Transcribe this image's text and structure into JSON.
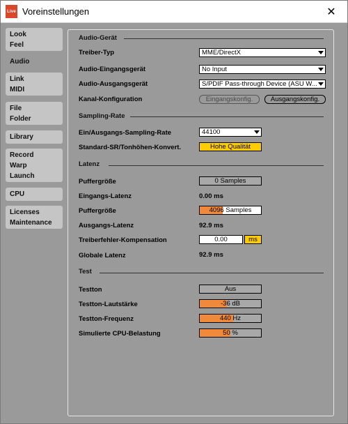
{
  "window": {
    "title": "Voreinstellungen",
    "app_icon_text": "Live",
    "close_glyph": "✕"
  },
  "sidebar": {
    "items": [
      {
        "lines": [
          "Look",
          "Feel"
        ],
        "active": false
      },
      {
        "lines": [
          "Audio"
        ],
        "active": true
      },
      {
        "lines": [
          "Link",
          "MIDI"
        ],
        "active": false
      },
      {
        "lines": [
          "File",
          "Folder"
        ],
        "active": false
      },
      {
        "lines": [
          "Library"
        ],
        "active": false
      },
      {
        "lines": [
          "Record",
          "Warp",
          "Launch"
        ],
        "active": false
      },
      {
        "lines": [
          "CPU"
        ],
        "active": false
      },
      {
        "lines": [
          "Licenses",
          "Maintenance"
        ],
        "active": false
      }
    ]
  },
  "audio_device": {
    "title": "Audio-Gerät",
    "driver_type": {
      "label": "Treiber-Typ",
      "value": "MME/DirectX"
    },
    "input_device": {
      "label": "Audio-Eingangsgerät",
      "value": "No Input"
    },
    "output_device": {
      "label": "Audio-Ausgangsgerät",
      "value": "S/PDIF Pass-through Device (ASU W..."
    },
    "channel_config": {
      "label": "Kanal-Konfiguration",
      "input_button": "Eingangskonfig.",
      "output_button": "Ausgangskonfig."
    }
  },
  "sampling_rate": {
    "title": "Sampling-Rate",
    "io_rate": {
      "label": "Ein/Ausgangs-Sampling-Rate",
      "value": "44100"
    },
    "default_sr": {
      "label": "Standard-SR/Tonhöhen-Konvert.",
      "value": "Hohe Qualität"
    }
  },
  "latency": {
    "title": "Latenz",
    "buffer_in": {
      "label": "Puffergröße",
      "value": "0 Samples"
    },
    "input_latency": {
      "label": "Eingangs-Latenz",
      "value": "0.00 ms"
    },
    "buffer_out": {
      "label": "Puffergröße",
      "value": "4096 Samples",
      "fill": 0.37
    },
    "output_latency": {
      "label": "Ausgangs-Latenz",
      "value": "92.9 ms"
    },
    "driver_comp": {
      "label": "Treiberfehler-Kompensation",
      "value": "0.00",
      "unit": "ms"
    },
    "overall_latency": {
      "label": "Globale Latenz",
      "value": "92.9 ms"
    }
  },
  "test": {
    "title": "Test",
    "tone": {
      "label": "Testton",
      "value": "Aus"
    },
    "volume": {
      "label": "Testton-Lautstärke",
      "value": "-36 dB",
      "fill": 0.44
    },
    "frequency": {
      "label": "Testton-Frequenz",
      "value": "440 Hz",
      "fill": 0.55
    },
    "cpu_load": {
      "label": "Simulierte CPU-Belastung",
      "value": "50 %",
      "fill": 0.5
    }
  },
  "colors": {
    "accent_orange": "#f08a3a",
    "highlight_yellow": "#ffcc00",
    "panel_gray": "#9a9a9a"
  }
}
